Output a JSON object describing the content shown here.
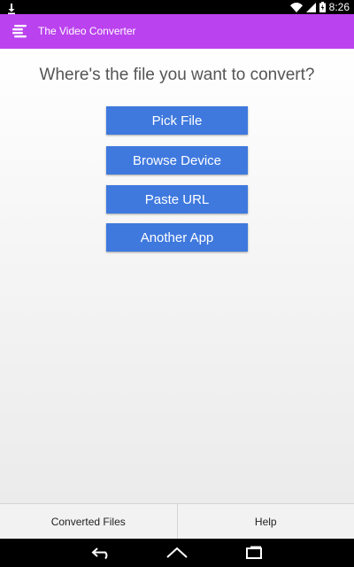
{
  "status_bar": {
    "time": "8:26",
    "icons": [
      "download-icon",
      "wifi-icon",
      "signal-icon",
      "battery-charging-icon"
    ]
  },
  "app_bar": {
    "title": "The Video Converter",
    "icon": "app-logo-icon",
    "color": "#bb42ef"
  },
  "main": {
    "heading": "Where's the file you want to convert?",
    "buttons": [
      {
        "label": "Pick File"
      },
      {
        "label": "Browse Device"
      },
      {
        "label": "Paste URL"
      },
      {
        "label": "Another App"
      }
    ],
    "button_color": "#3f79de"
  },
  "bottom_bar": {
    "tabs": [
      {
        "label": "Converted Files"
      },
      {
        "label": "Help"
      }
    ]
  },
  "nav_bar": {
    "buttons": [
      "back-icon",
      "home-icon",
      "recent-apps-icon"
    ]
  }
}
